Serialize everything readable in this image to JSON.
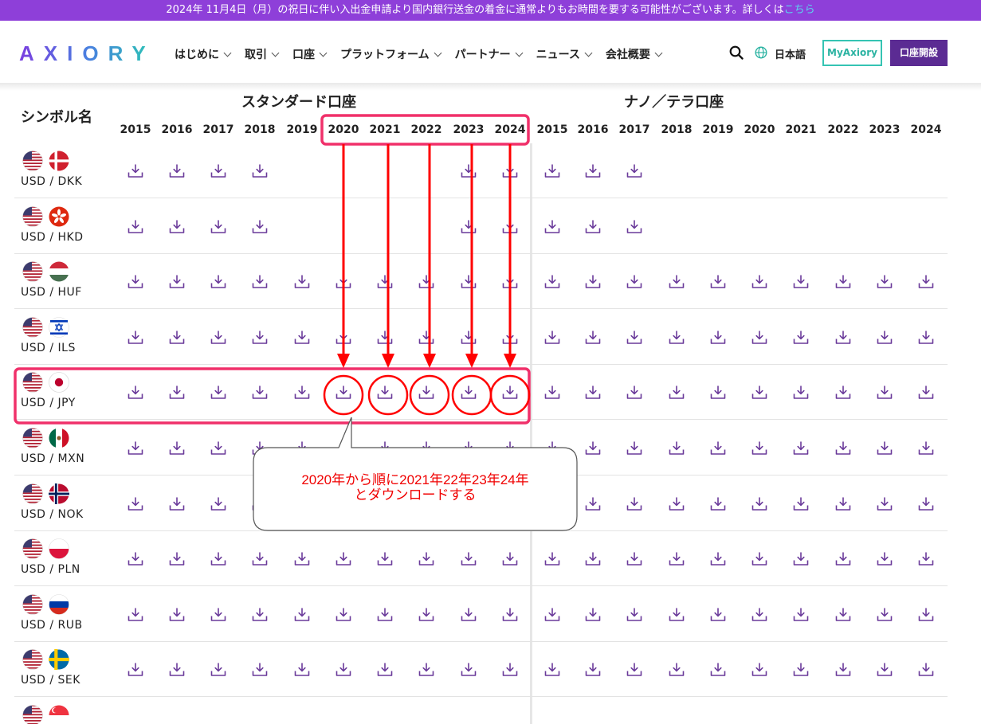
{
  "banner": {
    "text": "2024年 11月4日（月）の祝日に伴い入出金申請より国内銀行送金の着金に通常よりもお時間を要する可能性がございます。詳しくは",
    "link": "こちら"
  },
  "header": {
    "logo": "AXIORY",
    "nav": [
      "はじめに",
      "取引",
      "口座",
      "プラットフォーム",
      "パートナー",
      "ニュース",
      "会社概要"
    ],
    "language": "日本語",
    "myaxiory_label": "MyAxiory",
    "open_account_label": "口座開設"
  },
  "table": {
    "symbol_header": "シンボル名",
    "groups": [
      "スタンダード口座",
      "ナノ／テラ口座"
    ],
    "years": [
      "2015",
      "2016",
      "2017",
      "2018",
      "2019",
      "2020",
      "2021",
      "2022",
      "2023",
      "2024"
    ],
    "rows": [
      {
        "symbol": "USD / DKK",
        "flag": "dk",
        "standard": [
          1,
          1,
          1,
          1,
          0,
          0,
          0,
          0,
          1,
          1
        ],
        "nano": [
          1,
          1,
          1,
          0,
          0,
          0,
          0,
          0,
          0,
          0
        ]
      },
      {
        "symbol": "USD / HKD",
        "flag": "hk",
        "standard": [
          1,
          1,
          1,
          1,
          0,
          0,
          0,
          0,
          1,
          1
        ],
        "nano": [
          1,
          1,
          1,
          0,
          0,
          0,
          0,
          0,
          0,
          0
        ]
      },
      {
        "symbol": "USD / HUF",
        "flag": "hu",
        "standard": [
          1,
          1,
          1,
          1,
          1,
          1,
          1,
          1,
          1,
          1
        ],
        "nano": [
          1,
          1,
          1,
          1,
          1,
          1,
          1,
          1,
          1,
          1
        ]
      },
      {
        "symbol": "USD / ILS",
        "flag": "il",
        "standard": [
          1,
          1,
          1,
          1,
          1,
          1,
          1,
          1,
          1,
          1
        ],
        "nano": [
          1,
          1,
          1,
          1,
          1,
          1,
          1,
          1,
          1,
          1
        ]
      },
      {
        "symbol": "USD / JPY",
        "flag": "jp",
        "standard": [
          1,
          1,
          1,
          1,
          1,
          1,
          1,
          1,
          1,
          1
        ],
        "nano": [
          1,
          1,
          1,
          1,
          1,
          1,
          1,
          1,
          1,
          1
        ]
      },
      {
        "symbol": "USD / MXN",
        "flag": "mx",
        "standard": [
          1,
          1,
          1,
          1,
          1,
          1,
          1,
          1,
          1,
          1
        ],
        "nano": [
          1,
          1,
          1,
          1,
          1,
          1,
          1,
          1,
          1,
          1
        ]
      },
      {
        "symbol": "USD / NOK",
        "flag": "no",
        "standard": [
          1,
          1,
          1,
          1,
          1,
          1,
          1,
          1,
          1,
          1
        ],
        "nano": [
          1,
          1,
          1,
          1,
          1,
          1,
          1,
          1,
          1,
          1
        ]
      },
      {
        "symbol": "USD / PLN",
        "flag": "pl",
        "standard": [
          1,
          1,
          1,
          1,
          1,
          1,
          1,
          1,
          1,
          1
        ],
        "nano": [
          1,
          1,
          1,
          1,
          1,
          1,
          1,
          1,
          1,
          1
        ]
      },
      {
        "symbol": "USD / RUB",
        "flag": "ru",
        "standard": [
          1,
          1,
          1,
          1,
          1,
          1,
          1,
          1,
          1,
          1
        ],
        "nano": [
          1,
          1,
          1,
          1,
          1,
          1,
          1,
          1,
          1,
          1
        ]
      },
      {
        "symbol": "USD / SEK",
        "flag": "se",
        "standard": [
          1,
          1,
          1,
          1,
          1,
          1,
          1,
          1,
          1,
          1
        ],
        "nano": [
          1,
          1,
          1,
          1,
          1,
          1,
          1,
          1,
          1,
          1
        ]
      },
      {
        "symbol": "",
        "flag": "sg",
        "standard": [],
        "nano": []
      }
    ]
  },
  "annotation": {
    "callout_line1": "2020年から順に2021年22年23年24年",
    "callout_line2": "とダウンロードする",
    "highlight_color": "#f0306a",
    "arrow_color": "#ff0000"
  },
  "colors": {
    "banner": "#8e3fd9",
    "icon": "#6a3a9a",
    "primary_button": "#5b2b93",
    "secondary_button": "#35c4b3"
  }
}
